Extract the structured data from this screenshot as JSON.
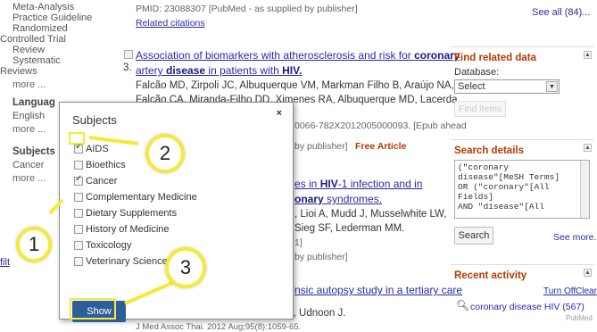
{
  "left_filters": {
    "article_types": [
      "Meta-Analysis",
      "Practice Guideline",
      "Randomized",
      "Controlled Trial",
      "Review",
      "Systematic",
      "Reviews"
    ],
    "article_more": "more ...",
    "language_heading": "Languag",
    "language_items": [
      "English"
    ],
    "language_more": "more ...",
    "subjects_heading": "Subjects",
    "subjects_items": [
      "Cancer"
    ],
    "subjects_more": "more ...",
    "side_link": "filt"
  },
  "results": {
    "top_meta": "PMID: 23088307 [PubMed - as supplied by publisher]",
    "top_related": "Related citations",
    "r3_number": "3.",
    "r3_title_a": "Association of biomarkers with atherosclerosis and risk for ",
    "r3_title_b": "coronary",
    "r3_title_c": "artery ",
    "r3_title_d": "disease",
    "r3_title_e": " in patients with ",
    "r3_title_f": "HIV.",
    "r3_authors_1": "Falcão MD, Zirpoli JC, Albuquerque VM, Markman Filho B, Araújo NA,",
    "r3_authors_2": "Falcão CA, Miranda-Filho DD, Ximenes RA, Albuquerque MD, Lacerda",
    "r3_doi": "0066-782X2012005000093. [Epub ahead",
    "r3_pub": "by publisher]",
    "r3_free": "Free Article",
    "r4_title_a": "es in ",
    "r4_title_b": "HIV",
    "r4_title_c": "-1 infection and in",
    "r4_title_d": "onary",
    "r4_title_e": " syndromes.",
    "r4_authors_1": ", Lioi A, Mudd J, Musselwhite LW,",
    "r4_authors_2": "Sieg SF, Lederman MM.",
    "r4_bracket": "1]",
    "r4_pub": "by publisher]",
    "r5_title": "nsic autopsy study in a tertiary care",
    "r5_authors": "Peonim V, Sujirachato K, Srisont S, Udnoon J.",
    "r5_journal": "J Med Assoc Thai. 2012 Aug;95(8):1059-65."
  },
  "popup": {
    "title": "Subjects",
    "close": "×",
    "options": [
      {
        "label": "AIDS",
        "checked": true
      },
      {
        "label": "Bioethics",
        "checked": false
      },
      {
        "label": "Cancer",
        "checked": true
      },
      {
        "label": "Complementary Medicine",
        "checked": false
      },
      {
        "label": "Dietary Supplements",
        "checked": false
      },
      {
        "label": "History of Medicine",
        "checked": false
      },
      {
        "label": "Toxicology",
        "checked": false
      },
      {
        "label": "Veterinary Science",
        "checked": false
      }
    ],
    "show_button": "Show"
  },
  "callouts": [
    "1",
    "2",
    "3"
  ],
  "sidebar": {
    "see_all": "See all (84)...",
    "find_related_title": "Find related data",
    "database_label": "Database:",
    "database_selected": "Select",
    "find_items_button": "Find items",
    "search_details_title": "Search details",
    "search_query": "(\"coronary\ndisease\"[MeSH Terms]\nOR (\"coronary\"[All\nFields]\nAND \"disease\"[All",
    "search_button": "Search",
    "see_more": "See more...",
    "recent_title": "Recent activity",
    "turn_off": "Turn Off",
    "clear": "Clear",
    "recent_item": "coronary disease HIV (567)",
    "recent_source": "PubMed"
  }
}
